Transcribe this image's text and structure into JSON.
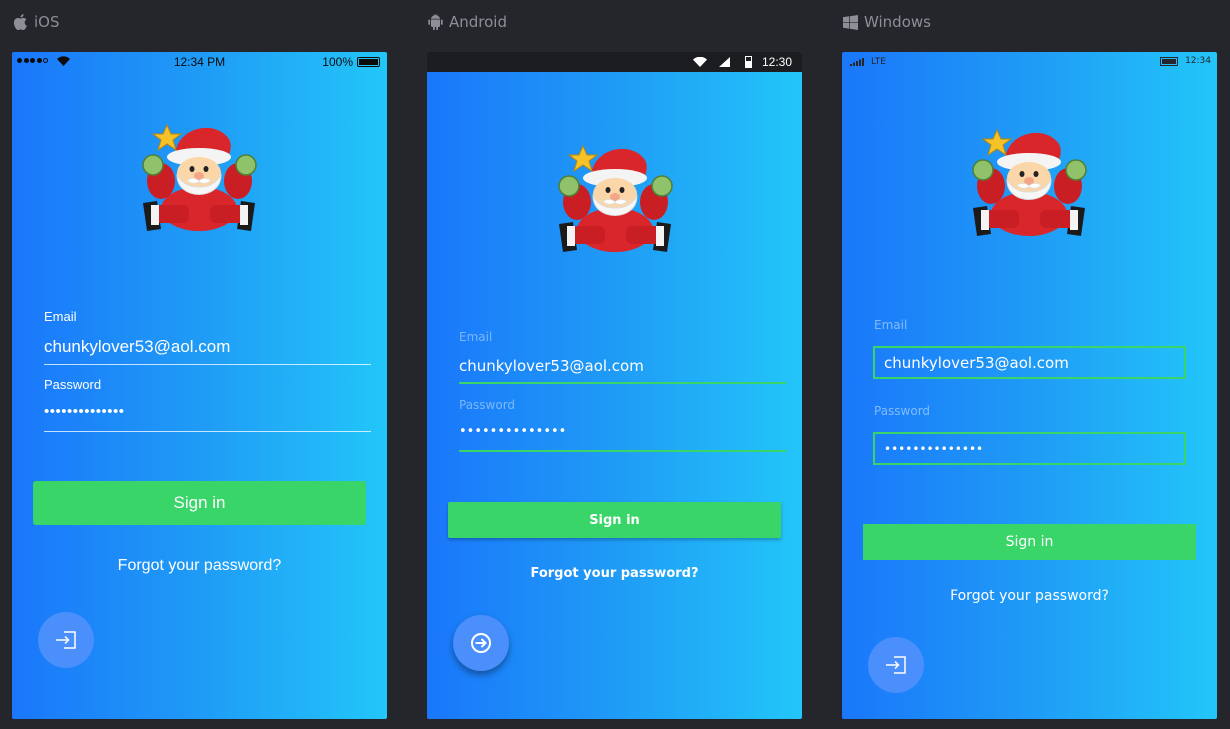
{
  "platforms": {
    "ios": {
      "label": "iOS"
    },
    "android": {
      "label": "Android"
    },
    "windows": {
      "label": "Windows"
    }
  },
  "ios": {
    "status": {
      "time": "12:34 PM",
      "battery": "100%"
    },
    "email_label": "Email",
    "email_value": "chunkylover53@aol.com",
    "password_label": "Password",
    "password_value": "••••••••••••••",
    "signin_label": "Sign in",
    "forgot_label": "Forgot your password?",
    "fab_icon": "sign-in-icon"
  },
  "android": {
    "status": {
      "time": "12:30"
    },
    "email_label": "Email",
    "email_value": "chunkylover53@aol.com",
    "password_label": "Password",
    "password_value": "••••••••••••••",
    "signin_label": "Sign in",
    "forgot_label": "Forgot your password?",
    "fab_icon": "circle-arrow-right-icon"
  },
  "windows": {
    "status": {
      "network": "LTE",
      "time": "12:34"
    },
    "email_label": "Email",
    "email_value": "chunkylover53@aol.com",
    "password_label": "Password",
    "password_value": "••••••••••••••",
    "signin_label": "Sign in",
    "forgot_label": "Forgot your password?",
    "fab_icon": "sign-in-icon"
  },
  "colors": {
    "background": "#24262b",
    "gradient_start": "#1a77fb",
    "gradient_end": "#23c6f9",
    "accent_green": "#3ad569",
    "fab_blue": "#4a8ffb"
  }
}
